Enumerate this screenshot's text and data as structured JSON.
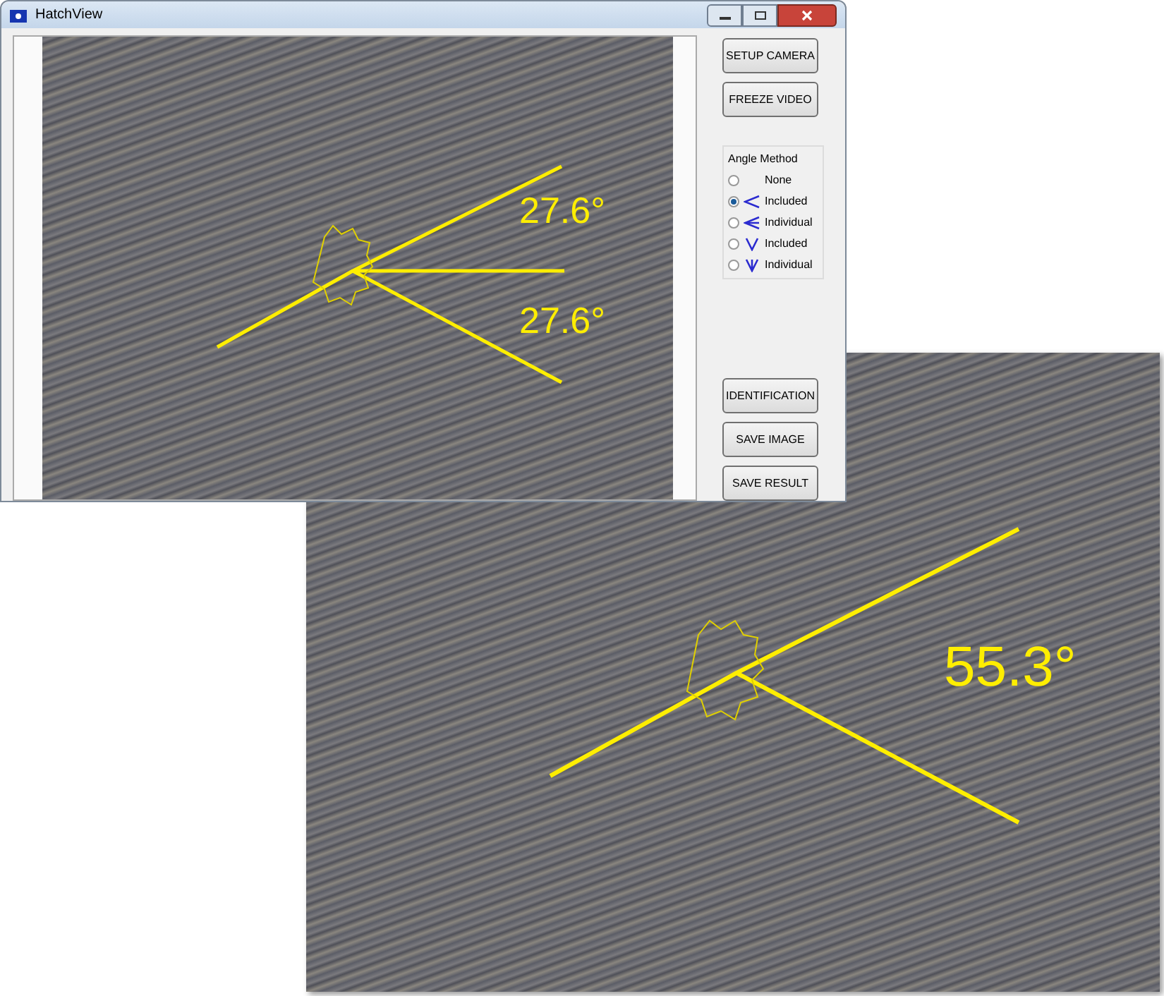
{
  "window": {
    "title": "HatchView"
  },
  "video": {
    "angle_labels": [
      "27.6°",
      "27.6°"
    ]
  },
  "buttons_top": [
    "SETUP CAMERA",
    "FREEZE VIDEO"
  ],
  "angle_method": {
    "title": "Angle Method",
    "options": [
      {
        "label": "None",
        "kind": "none",
        "selected": false
      },
      {
        "label": "Included",
        "kind": "horizontal-included",
        "selected": true
      },
      {
        "label": "Individual",
        "kind": "horizontal-individual",
        "selected": false
      },
      {
        "label": "Included",
        "kind": "vertical-included",
        "selected": false
      },
      {
        "label": "Individual",
        "kind": "vertical-individual",
        "selected": false
      }
    ]
  },
  "buttons_bottom": [
    "IDENTIFICATION",
    "SAVE IMAGE",
    "SAVE RESULT"
  ],
  "zoomed_view": {
    "angle_label": "55.3°"
  }
}
